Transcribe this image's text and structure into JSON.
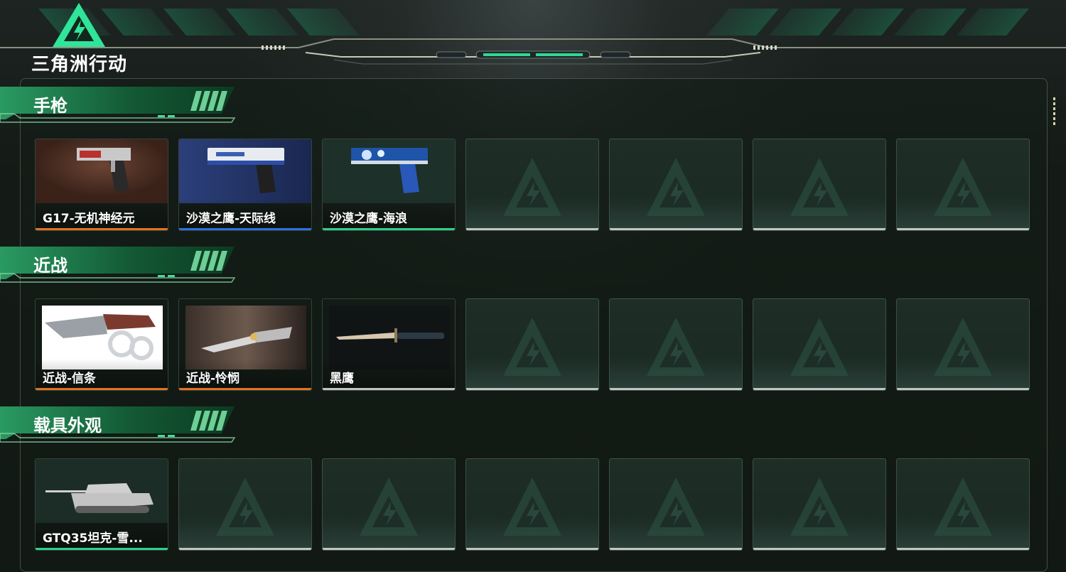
{
  "app": {
    "logo_text": "三角洲行动",
    "logo_icon": "lightning-triangle-icon"
  },
  "colors": {
    "orange": "#e0731d",
    "blue": "#2d6fe0",
    "green": "#2fd08a",
    "gray": "#bfc5c2"
  },
  "sections": [
    {
      "title": "手枪",
      "items": [
        {
          "name": "G17-无机神经元",
          "rarity": "orange",
          "art": "pistol-glock-icon"
        },
        {
          "name": "沙漠之鹰-天际线",
          "rarity": "blue",
          "art": "pistol-deagle-white-icon"
        },
        {
          "name": "沙漠之鹰-海浪",
          "rarity": "green",
          "art": "pistol-deagle-blue-icon"
        }
      ]
    },
    {
      "title": "近战",
      "items": [
        {
          "name": "近战-信条",
          "rarity": "orange",
          "art": "knife-creed-icon"
        },
        {
          "name": "近战-怜悯",
          "rarity": "orange",
          "art": "knife-mercy-icon"
        },
        {
          "name": "黑鹰",
          "rarity": "gray",
          "art": "knife-blackhawk-icon"
        }
      ]
    },
    {
      "title": "载具外观",
      "items": [
        {
          "name": "GTQ35坦克-雪...",
          "rarity": "green",
          "art": "tank-snow-icon"
        }
      ]
    }
  ]
}
